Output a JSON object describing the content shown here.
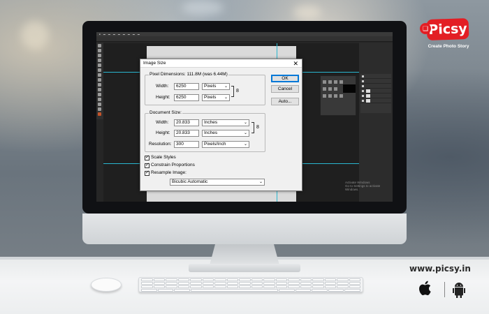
{
  "brand": {
    "logo_text": "Picsy",
    "tagline": "Create Photo Story",
    "website": "www.picsy.in"
  },
  "screen": {
    "watermark_line1": "Activate Windows",
    "watermark_line2": "Go to Settings to activate Windows."
  },
  "dialog": {
    "title": "Image Size",
    "close_glyph": "✕",
    "pixel_dimensions": {
      "label": "Pixel Dimensions:  111.8M (was 6.44M)",
      "width_label": "Width:",
      "width_value": "6250",
      "width_unit": "Pixels",
      "height_label": "Height:",
      "height_value": "6250",
      "height_unit": "Pixels"
    },
    "document_size": {
      "label": "Document Size:",
      "width_label": "Width:",
      "width_value": "20.833",
      "width_unit": "Inches",
      "height_label": "Height:",
      "height_value": "20.833",
      "height_unit": "Inches",
      "resolution_label": "Resolution:",
      "resolution_value": "300",
      "resolution_unit": "Pixels/Inch"
    },
    "buttons": {
      "ok": "OK",
      "cancel": "Cancel",
      "auto": "Auto..."
    },
    "options": {
      "scale_styles": "Scale Styles",
      "constrain_proportions": "Constrain Proportions",
      "resample_image": "Resample Image:",
      "resample_method": "Bicubic Automatic"
    },
    "dropdown_arrow": "⌄",
    "link_glyph": "8"
  },
  "colors": {
    "logo_red": "#e31e24",
    "guide_cyan": "#2ab7d0",
    "dialog_bg": "#f0f0f0"
  }
}
